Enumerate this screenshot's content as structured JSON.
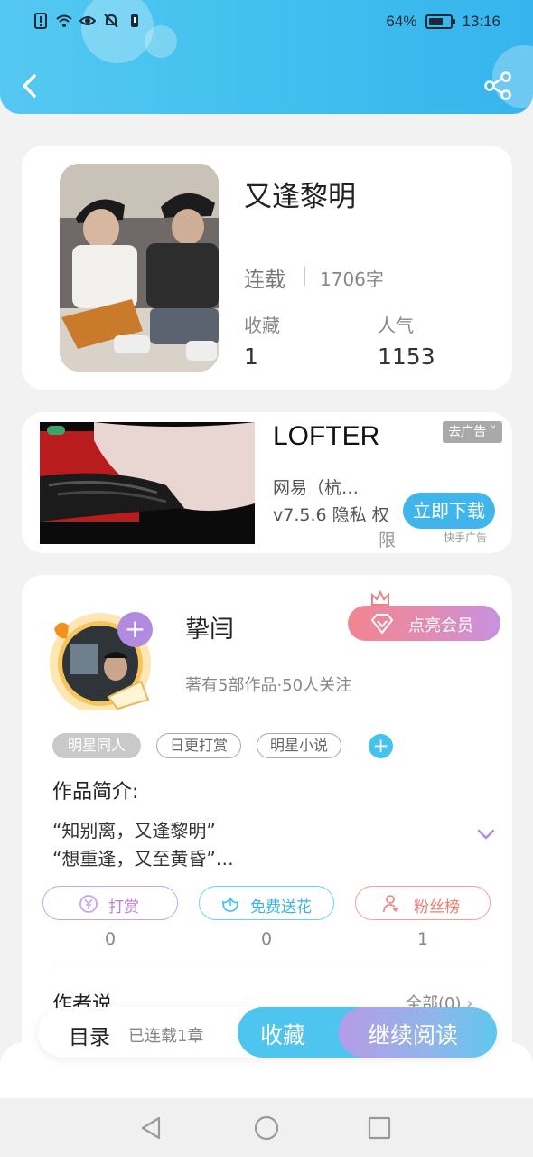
{
  "status_bar": {
    "battery_text": "64%",
    "battery_level": 0.64,
    "time": "13:16"
  },
  "header": {
    "back_icon": "chevron-left-icon",
    "share_icon": "share-icon"
  },
  "book": {
    "title": "又逢黎明",
    "status": "连载",
    "word_count": "1706字",
    "stats": [
      {
        "label": "收藏",
        "value": "1"
      },
      {
        "label": "人气",
        "value": "1153"
      }
    ]
  },
  "ad": {
    "app_name": "LOFTER",
    "remove_label": "去广告",
    "line1": "网易（杭…",
    "line2": "v7.5.6  隐私  权",
    "line3": "限",
    "download_label": "立即下载",
    "source": "快手广告"
  },
  "author": {
    "name": "挚闫",
    "meta": "著有5部作品·50人关注",
    "vip_label": "点亮会员",
    "tags": [
      "明星同人",
      "日更打赏",
      "明星小说"
    ],
    "intro_title": "作品简介:",
    "intro_lines": [
      "“知别离，又逢黎明”",
      "“想重逢，又至黄昏”…"
    ],
    "actions": [
      {
        "label": "打赏",
        "icon": "yen-coin-icon",
        "count": "0",
        "color": "#c28fe0"
      },
      {
        "label": "免费送花",
        "icon": "flower-icon",
        "count": "0",
        "color": "#45c3ee"
      },
      {
        "label": "粉丝榜",
        "icon": "fan-person-icon",
        "count": "1",
        "color": "#f08a84"
      }
    ],
    "section_title": "作者说",
    "section_more": "全部(0)"
  },
  "reader_bar": {
    "toc_label": "目录",
    "toc_sub": "已连载1章",
    "favorite_label": "收藏",
    "continue_label": "继续阅读"
  },
  "nav": {
    "icons": [
      "back-triangle-icon",
      "home-circle-icon",
      "recent-square-icon"
    ]
  },
  "colors": {
    "primary": "#45c3ee",
    "accent_purple": "#b08be0",
    "vip_pink": "#f28590"
  }
}
